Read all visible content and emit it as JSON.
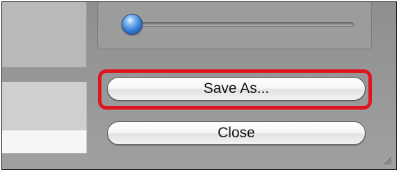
{
  "dialog": {
    "slider": {
      "value": 0
    },
    "buttons": {
      "save_as_label": "Save As...",
      "close_label": "Close"
    },
    "highlight_color": "#e0141e",
    "icons": {
      "grip": "resize-grip-icon",
      "knob": "slider-knob"
    }
  }
}
